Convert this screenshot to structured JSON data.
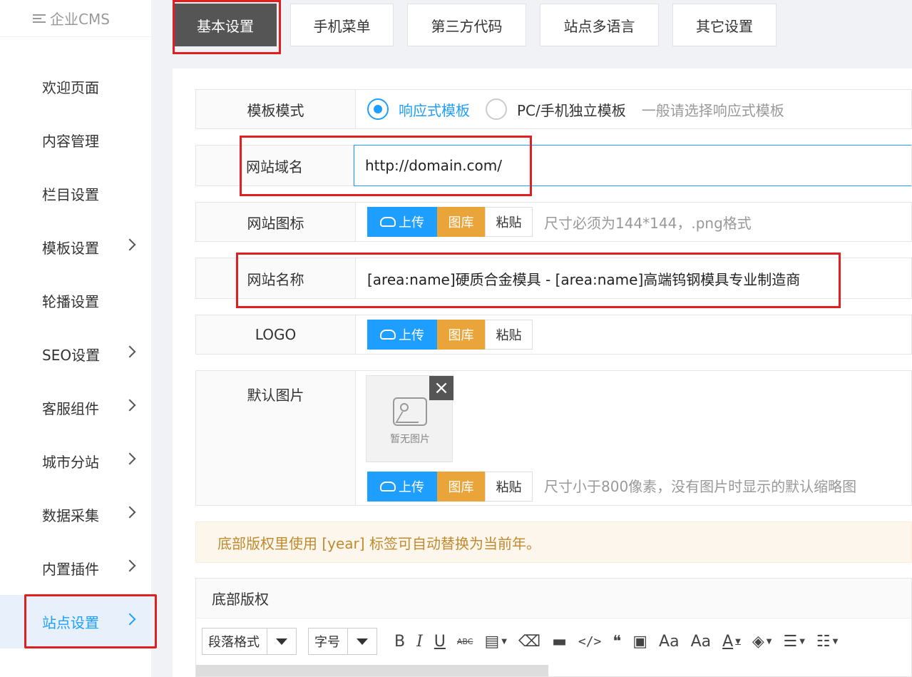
{
  "brand": {
    "title": "企业CMS"
  },
  "sidebar": {
    "items": [
      {
        "label": "欢迎页面",
        "has_children": false
      },
      {
        "label": "内容管理",
        "has_children": false
      },
      {
        "label": "栏目设置",
        "has_children": false
      },
      {
        "label": "模板设置",
        "has_children": true
      },
      {
        "label": "轮播设置",
        "has_children": false
      },
      {
        "label": "SEO设置",
        "has_children": true
      },
      {
        "label": "客服组件",
        "has_children": true
      },
      {
        "label": "城市分站",
        "has_children": true
      },
      {
        "label": "数据采集",
        "has_children": true
      },
      {
        "label": "内置插件",
        "has_children": true
      },
      {
        "label": "站点设置",
        "has_children": true,
        "active": true
      }
    ]
  },
  "tabs": [
    {
      "label": "基本设置",
      "active": true
    },
    {
      "label": "手机菜单"
    },
    {
      "label": "第三方代码"
    },
    {
      "label": "站点多语言"
    },
    {
      "label": "其它设置"
    }
  ],
  "form": {
    "template_mode": {
      "label": "模板模式",
      "options": [
        "响应式模板",
        "PC/手机独立模板"
      ],
      "selected": "响应式模板",
      "hint": "一般请选择响应式模板"
    },
    "domain": {
      "label": "网站域名",
      "value": "http://domain.com/"
    },
    "favicon": {
      "label": "网站图标",
      "hint": "尺寸必须为144*144，.png格式"
    },
    "site_name": {
      "label": "网站名称",
      "value": "[area:name]硬质合金模具 - [area:name]高端钨钢模具专业制造商"
    },
    "logo": {
      "label": "LOGO"
    },
    "default_image": {
      "label": "默认图片",
      "placeholder": "暂无图片",
      "hint": "尺寸小于800像素，没有图片时显示的默认缩略图"
    },
    "buttons": {
      "upload": "上传",
      "gallery": "图库",
      "paste": "粘贴"
    }
  },
  "notice": {
    "text": "底部版权里使用 [year] 标签可自动替换为当前年。"
  },
  "editor": {
    "title": "底部版权",
    "paragraph_select": "段落格式",
    "size_select": "字号"
  },
  "colors": {
    "accent": "#1e9fff",
    "gallery": "#e9a53a",
    "highlight": "#e02020",
    "active_tab": "#555555"
  }
}
